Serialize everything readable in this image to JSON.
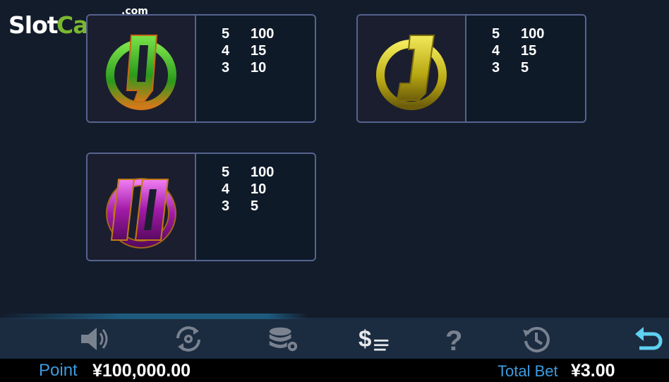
{
  "logo": {
    "slot": "Slot",
    "catalog": "Catalog",
    "com": ".com"
  },
  "paytable": [
    {
      "symbol": "green-q-icon",
      "color": "#3eb023",
      "rows": [
        {
          "count": "5",
          "pay": "100"
        },
        {
          "count": "4",
          "pay": "15"
        },
        {
          "count": "3",
          "pay": "10"
        }
      ]
    },
    {
      "symbol": "yellow-j-icon",
      "color": "#d5c818",
      "rows": [
        {
          "count": "5",
          "pay": "100"
        },
        {
          "count": "4",
          "pay": "15"
        },
        {
          "count": "3",
          "pay": "5"
        }
      ]
    },
    {
      "symbol": "purple-10-icon",
      "color": "#b21fb8",
      "rows": [
        {
          "count": "5",
          "pay": "100"
        },
        {
          "count": "4",
          "pay": "10"
        },
        {
          "count": "3",
          "pay": "5"
        }
      ]
    }
  ],
  "toolbar": {
    "buttons": [
      "sound-icon",
      "autoplay-icon",
      "bet-settings-icon",
      "paytable-icon",
      "help-icon",
      "history-icon",
      "back-icon"
    ]
  },
  "status": {
    "point_label": "Point",
    "point_value": "¥100,000.00",
    "total_bet_label": "Total Bet",
    "total_bet_value": "¥3.00"
  }
}
